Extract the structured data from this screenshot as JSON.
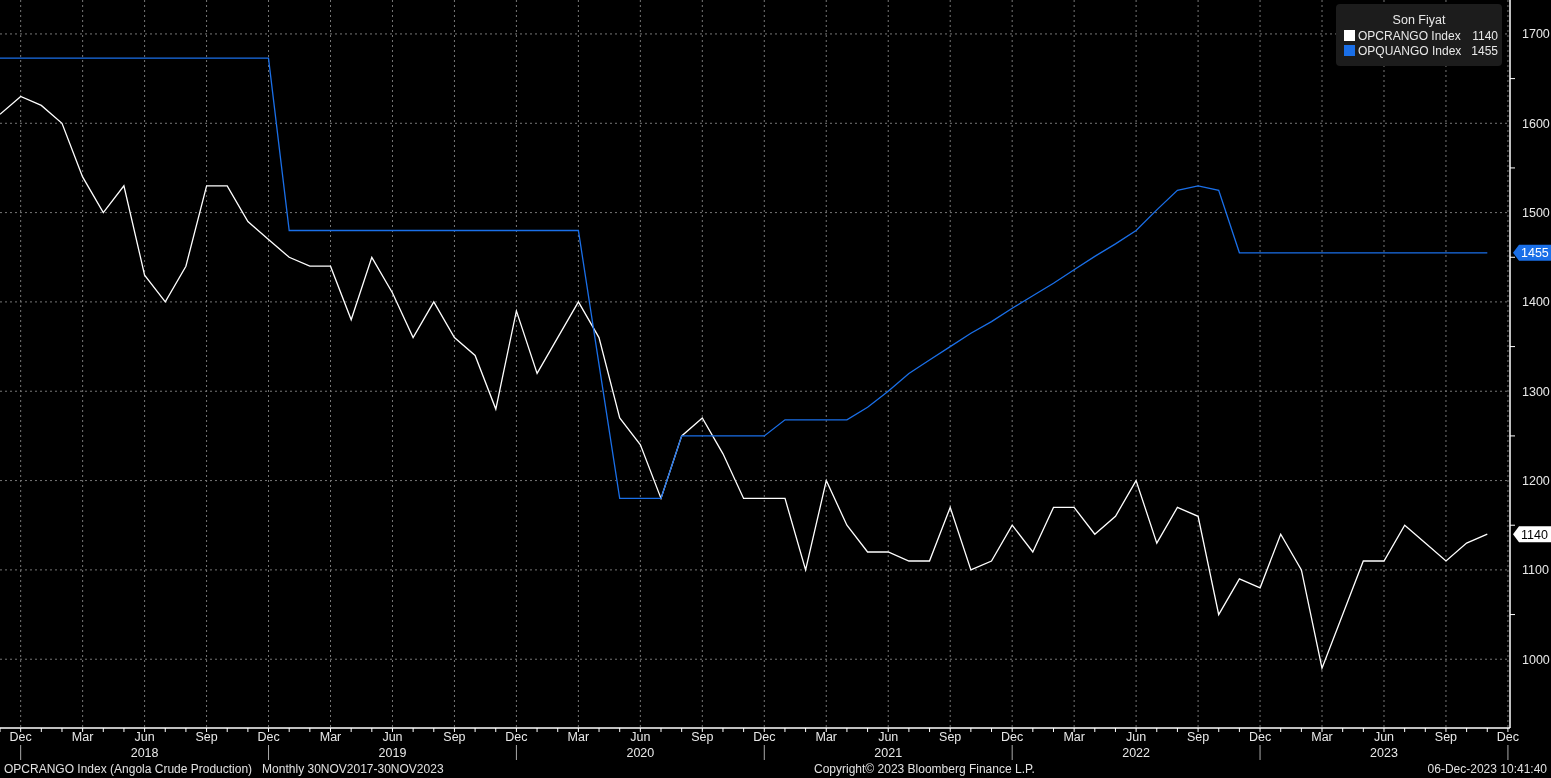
{
  "chart": {
    "chart_data": {
      "type": "line",
      "grid": true,
      "legend": "upper right",
      "categories": [
        null,
        "Dec",
        null,
        null,
        "Mar",
        null,
        null,
        "Jun",
        null,
        null,
        "Sep",
        null,
        null,
        "Dec",
        null,
        null,
        "Mar",
        null,
        null,
        "Jun",
        null,
        null,
        "Sep",
        null,
        null,
        "Dec",
        null,
        null,
        "Mar",
        null,
        null,
        "Jun",
        null,
        null,
        "Sep",
        null,
        null,
        "Dec",
        null,
        null,
        "Mar",
        null,
        null,
        "Jun",
        null,
        null,
        "Sep",
        null,
        null,
        "Dec",
        null,
        null,
        "Mar",
        null,
        null,
        "Jun",
        null,
        null,
        "Sep",
        null,
        null,
        "Dec",
        null,
        null,
        "Mar",
        null,
        null,
        "Jun",
        null,
        null,
        "Sep",
        null,
        null,
        "Dec"
      ],
      "series": [
        {
          "name": "OPCRANGO Index",
          "color": "#ffffff",
          "values": [
            1610,
            1630,
            1620,
            1600,
            1540,
            1500,
            1530,
            1430,
            1400,
            1440,
            1530,
            1530,
            1490,
            1470,
            1450,
            1440,
            1440,
            1380,
            1450,
            1410,
            1360,
            1400,
            1360,
            1340,
            1280,
            1390,
            1320,
            1360,
            1400,
            1360,
            1270,
            1240,
            1180,
            1250,
            1270,
            1230,
            1180,
            1180,
            1180,
            1100,
            1200,
            1150,
            1120,
            1120,
            1110,
            1110,
            1170,
            1100,
            1110,
            1150,
            1120,
            1170,
            1170,
            1140,
            1160,
            1200,
            1130,
            1170,
            1160,
            1050,
            1090,
            1080,
            1140,
            1100,
            990,
            1050,
            1110,
            1110,
            1150,
            1130,
            1110,
            1130,
            1140,
            null
          ]
        },
        {
          "name": "OPQUANGO Index",
          "color": "#1a6fe8",
          "values": [
            1673,
            1673,
            1673,
            1673,
            1673,
            1673,
            1673,
            1673,
            1673,
            1673,
            1673,
            1673,
            1673,
            1673,
            1480,
            1480,
            1480,
            1480,
            1480,
            1480,
            1480,
            1480,
            1480,
            1480,
            1480,
            1480,
            1480,
            1480,
            1480,
            1330,
            1180,
            1180,
            1180,
            1250,
            1250,
            1250,
            1250,
            1250,
            1268,
            1268,
            1268,
            1268,
            1282,
            1300,
            1320,
            1335,
            1350,
            1365,
            1378,
            1393,
            1407,
            1421,
            1436,
            1451,
            1465,
            1480,
            1503,
            1525,
            1530,
            1525,
            1455,
            1455,
            1455,
            1455,
            1455,
            1455,
            1455,
            1455,
            1455,
            1455,
            1455,
            1455,
            1455,
            null
          ]
        }
      ],
      "ylim": [
        923,
        1738
      ],
      "yticks": [
        1000,
        1100,
        1200,
        1300,
        1400,
        1500,
        1600,
        1700
      ]
    },
    "year_labels": [
      "2018",
      "2019",
      "2020",
      "2021",
      "2022",
      "2023"
    ],
    "legend": {
      "title": "Son Fiyat",
      "values": [
        "1140",
        "1455"
      ]
    },
    "last_value_badges": [
      "1455",
      "1140"
    ]
  },
  "footer": {
    "security": "OPCRANGO Index (Angola Crude Production)",
    "period": "Monthly 30NOV2017-30NOV2023",
    "copyright": "Copyright© 2023 Bloomberg Finance L.P.",
    "timestamp": "06-Dec-2023 10:41:40"
  }
}
